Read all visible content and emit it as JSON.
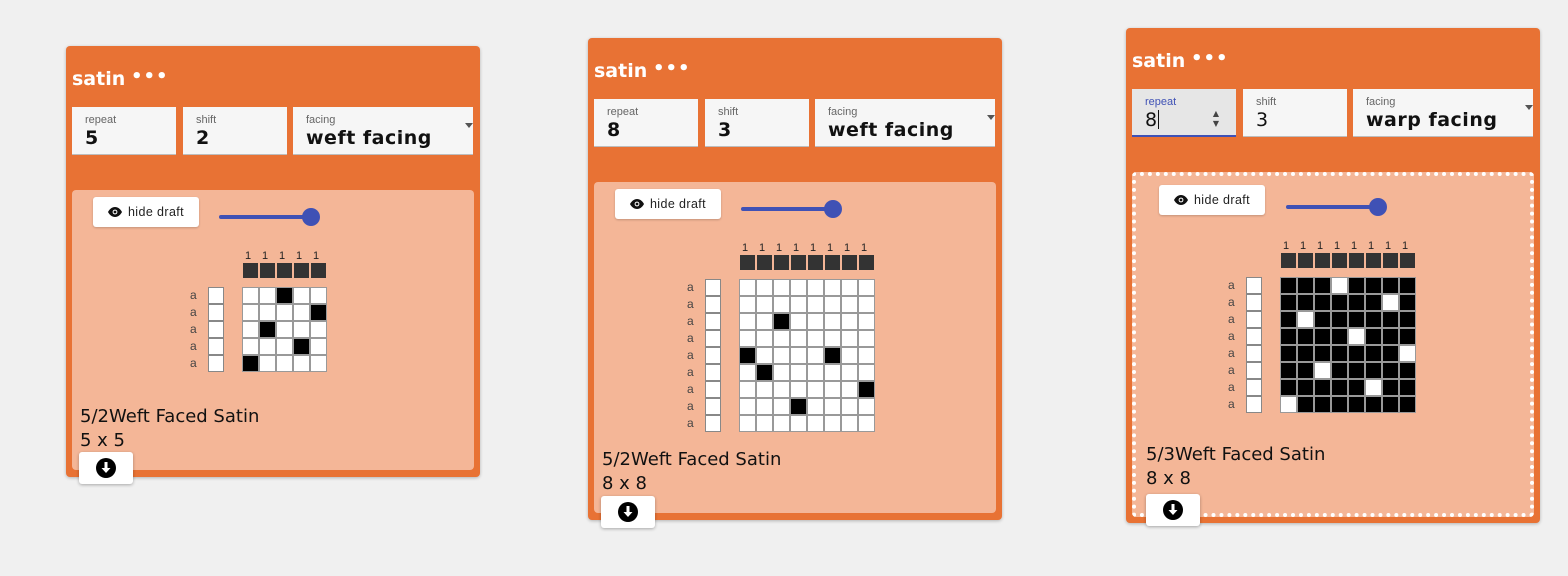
{
  "nodes": [
    {
      "title": "satin",
      "repeat_label": "repeat",
      "repeat_value": "5",
      "shift_label": "shift",
      "shift_value": "2",
      "facing_label": "facing",
      "facing_value": "weft facing",
      "hide_draft_label": "hide draft",
      "slider_level": 1.0,
      "warp_numbers": [
        "1",
        "1",
        "1",
        "1",
        "1"
      ],
      "weft_labels": [
        "a",
        "a",
        "a",
        "a",
        "a"
      ],
      "grid": [
        "00100",
        "00001",
        "01000",
        "00010",
        "10000"
      ],
      "pattern_name": "5/2Weft Faced Satin",
      "pattern_dims": "5 x 5",
      "selected": false,
      "repeat_focused": false
    },
    {
      "title": "satin",
      "repeat_label": "repeat",
      "repeat_value": "8",
      "shift_label": "shift",
      "shift_value": "3",
      "facing_label": "facing",
      "facing_value": "weft facing",
      "hide_draft_label": "hide draft",
      "slider_level": 1.0,
      "warp_numbers": [
        "1",
        "1",
        "1",
        "1",
        "1",
        "1",
        "1",
        "1"
      ],
      "weft_labels": [
        "a",
        "a",
        "a",
        "a",
        "a",
        "a",
        "a",
        "a"
      ],
      "grid": [
        "00000000",
        "00000000",
        "00100000",
        "00000000",
        "10000100",
        "01000000",
        "00000001",
        "00010000",
        "00000000"
      ],
      "pattern_name": "5/2Weft Faced Satin",
      "pattern_dims": "8 x 8",
      "selected": false,
      "repeat_focused": false
    },
    {
      "title": "satin",
      "repeat_label": "repeat",
      "repeat_value": "8",
      "shift_label": "shift",
      "shift_value": "3",
      "facing_label": "facing",
      "facing_value": "warp facing",
      "hide_draft_label": "hide draft",
      "slider_level": 1.0,
      "warp_numbers": [
        "1",
        "1",
        "1",
        "1",
        "1",
        "1",
        "1",
        "1"
      ],
      "weft_labels": [
        "a",
        "a",
        "a",
        "a",
        "a",
        "a",
        "a",
        "a"
      ],
      "grid": [
        "11101111",
        "11111101",
        "10111111",
        "11110111",
        "11111110",
        "11011111",
        "11111011",
        "01111111"
      ],
      "pattern_name": "5/3Weft Faced Satin",
      "pattern_dims": "8 x 8",
      "selected": true,
      "repeat_focused": true
    }
  ],
  "icons": {
    "more": "more-horizontal-icon",
    "eye": "eye-icon",
    "download": "download-icon",
    "dropdown": "chevron-down-icon"
  },
  "colors": {
    "node": "#e87234",
    "panel": "#f4b697",
    "accent": "#3f51b5",
    "threading": "#333333"
  }
}
